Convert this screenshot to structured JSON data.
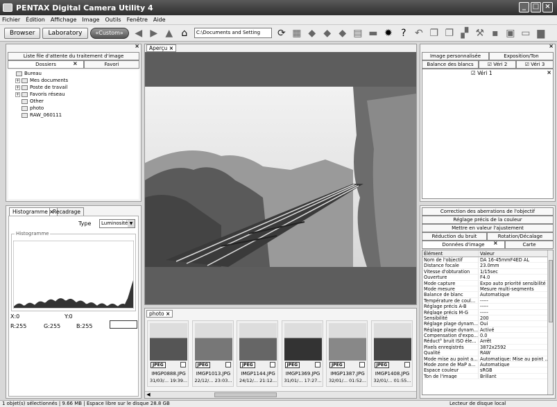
{
  "window": {
    "title": "PENTAX Digital Camera Utility 4"
  },
  "menu": [
    "Fichier",
    "Édition",
    "Affichage",
    "Image",
    "Outils",
    "Fenêtre",
    "Aide"
  ],
  "toolbar": {
    "browser": "Browser",
    "laboratory": "Laboratory",
    "custom": "«Custom»",
    "path": "C:\\Documents and Setting"
  },
  "left_top": {
    "queue_tab": "Liste file d'attente du traitement d'image",
    "folders_tab": "Dossiers",
    "favorites_tab": "Favori",
    "tree": [
      {
        "label": "Bureau",
        "level": 0,
        "expand": ""
      },
      {
        "label": "Mes documents",
        "level": 1,
        "expand": "+"
      },
      {
        "label": "Poste de travail",
        "level": 1,
        "expand": "+"
      },
      {
        "label": "Favoris réseau",
        "level": 1,
        "expand": "+"
      },
      {
        "label": "Other",
        "level": 1,
        "expand": ""
      },
      {
        "label": "photo",
        "level": 1,
        "expand": ""
      },
      {
        "label": "RAW_060111",
        "level": 1,
        "expand": ""
      }
    ]
  },
  "histogram": {
    "tab_histogram": "Histogramme",
    "tab_crop": "Recadrage",
    "type_label": "Type",
    "type_value": "Luminosité",
    "group_label": "Histogramme",
    "x": "X:0",
    "y": "Y:0",
    "r": "R:255",
    "g": "G:255",
    "b": "B:255"
  },
  "preview": {
    "tab": "Aperçu"
  },
  "filmstrip": {
    "tab": "photo",
    "items": [
      {
        "name": "IMGP0888.JPG",
        "date": "31/03/... 19:39..."
      },
      {
        "name": "IMGP1013.JPG",
        "date": "22/12/... 23:03..."
      },
      {
        "name": "IMGP1144.JPG",
        "date": "24/12/... 21:12..."
      },
      {
        "name": "IMGP1369.JPG",
        "date": "31/01/... 17:27..."
      },
      {
        "name": "IMGP1387.JPG",
        "date": "32/01/... 01:52..."
      },
      {
        "name": "IMGP1408.JPG",
        "date": "32/01/... 01:55..."
      }
    ],
    "badge": "JPEG"
  },
  "right_top": {
    "tab_custom_image": "Image personnalisée",
    "tab_exposure": "Exposition/Ton",
    "tab_wb": "Balance des blancs",
    "tab_check2": "Véri 2",
    "tab_check3": "Véri 3",
    "tab_check1": "Véri 1"
  },
  "right_bottom": {
    "btn_aberration": "Correction des aberrations de l'objectif",
    "btn_color": "Réglage précis de la couleur",
    "btn_level": "Mettre en valeur l'ajustement",
    "tab_noise": "Réduction du bruit",
    "tab_rotation": "Rotation/Décalage",
    "tab_image_data": "Données d'image",
    "tab_map": "Carte",
    "col_element": "Élément",
    "col_value": "Valeur",
    "rows": [
      [
        "Nom de l'objectif",
        "DA 16-45mmF4ED AL"
      ],
      [
        "Distance focale",
        "23.0mm"
      ],
      [
        "Vitesse d'obturation",
        "1/15sec"
      ],
      [
        "Ouverture",
        "F4.0"
      ],
      [
        "Mode capture",
        "Expo auto priorité sensibilité"
      ],
      [
        "Mode mesure",
        "Mesure multi-segments"
      ],
      [
        "Balance de blanc",
        "Automatique"
      ],
      [
        "Température de coul...",
        "-----"
      ],
      [
        "Réglage précis A-B",
        "-----"
      ],
      [
        "Réglage précis M-G",
        "-----"
      ],
      [
        "Sensibilité",
        "200"
      ],
      [
        "Réglage plage dynam...",
        "Oui"
      ],
      [
        "Réglage plage dynam...",
        "Activé"
      ],
      [
        "Compensation d'expo...",
        "0.0"
      ],
      [
        "Réduct° bruit ISO éle...",
        "Arrêt"
      ],
      [
        "Pixels enregistrés",
        "3872x2592"
      ],
      [
        "Qualité",
        "RAW"
      ],
      [
        "Mode mise au point a...",
        "Automatique: Mise au point ..."
      ],
      [
        "Mode zone de MaP a...",
        "Automatique"
      ],
      [
        "Espace couleur",
        "sRGB"
      ],
      [
        "Ton de l'image",
        "Brillant"
      ]
    ]
  },
  "status": {
    "left": "1 objet(s) sélectionnés | 9.66 MB | Espace libre sur le disque 28.8 GB",
    "right": "Lecteur de disque local"
  }
}
